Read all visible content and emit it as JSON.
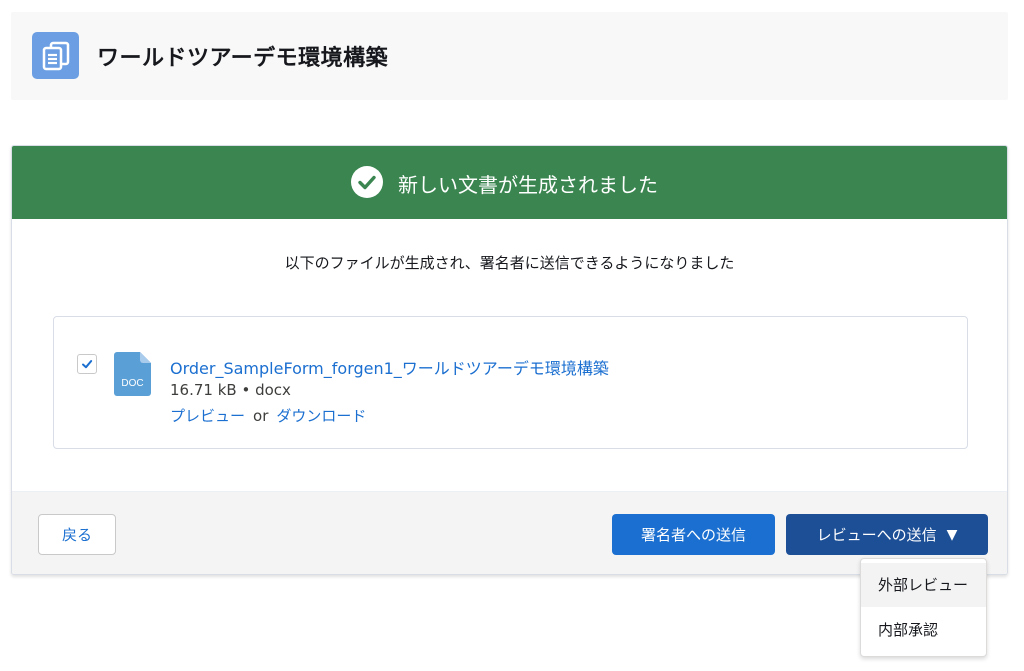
{
  "header": {
    "title": "ワールドツアーデモ環境構築",
    "icon": "document-icon"
  },
  "banner": {
    "message": "新しい文書が生成されました",
    "icon": "check-circle-icon",
    "color": "#3a8550"
  },
  "subtitle": "以下のファイルが生成され、署名者に送信できるようになりました",
  "file": {
    "checked": true,
    "icon_label": "DOC",
    "name": "Order_SampleForm_forgen1_ワールドツアーデモ環境構築",
    "meta": "16.71 kB • docx",
    "preview_label": "プレビュー",
    "or_label": "or",
    "download_label": "ダウンロード"
  },
  "footer": {
    "back_label": "戻る",
    "send_signers_label": "署名者への送信",
    "send_review_label": "レビューへの送信"
  },
  "dropdown": {
    "items": [
      {
        "label": "外部レビュー"
      },
      {
        "label": "内部承認"
      }
    ]
  },
  "colors": {
    "primary": "#1b6fd0",
    "primary_dark": "#1d4f97",
    "header_icon": "#6b9ee2",
    "doc_icon": "#5a9fd6"
  }
}
